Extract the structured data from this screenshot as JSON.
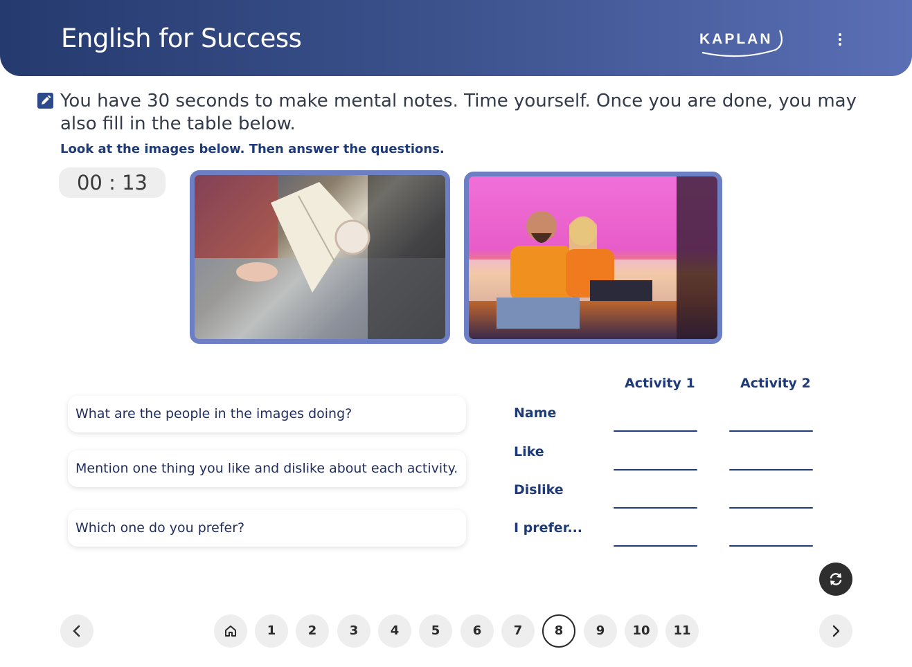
{
  "header": {
    "title": "English for Success",
    "logo_text": "KAPLAN"
  },
  "task": {
    "instruction": "You have 30 seconds to make mental notes. Time yourself. Once you are done, you may also fill in the table below.",
    "subinstruction": "Look at the images below. Then answer the questions."
  },
  "timer": {
    "value": "00 : 13"
  },
  "questions": [
    "What are the people in the images doing?",
    "Mention one thing you like and dislike about each activity.",
    "Which one do you prefer?"
  ],
  "table": {
    "columns": [
      "Activity 1",
      "Activity 2"
    ],
    "rows": [
      "Name",
      "Like",
      "Dislike",
      "I prefer..."
    ]
  },
  "pagination": {
    "pages": [
      "1",
      "2",
      "3",
      "4",
      "5",
      "6",
      "7",
      "8",
      "9",
      "10",
      "11"
    ],
    "current": "8"
  },
  "icons": {
    "menu": "kebab-menu-icon",
    "edit": "edit-icon",
    "refresh": "refresh-icon",
    "home": "home-icon",
    "prev": "chevron-left-icon",
    "next": "chevron-right-icon"
  },
  "colors": {
    "accent": "#1f3a78",
    "header_start": "#253a6e",
    "header_end": "#5a6fb5",
    "photo_border": "#6d7fc4"
  }
}
